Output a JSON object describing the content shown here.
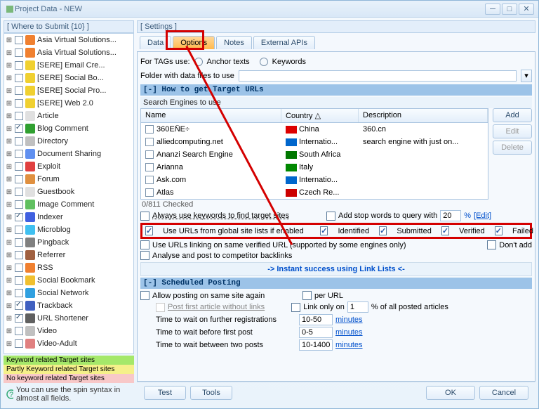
{
  "window": {
    "title": "Project Data - NEW"
  },
  "left_panel": {
    "header": "[ Where to Submit  {10} ]",
    "items": [
      {
        "label": "Asia Virtual Solutions...",
        "chk": false,
        "icon": "#f08030"
      },
      {
        "label": "Asia Virtual Solutions...",
        "chk": false,
        "icon": "#f08030"
      },
      {
        "label": "[SERE] Email Cre...",
        "chk": false,
        "icon": "#f0d030"
      },
      {
        "label": "[SERE] Social Bo...",
        "chk": false,
        "icon": "#f0d030"
      },
      {
        "label": "[SERE] Social Pro...",
        "chk": false,
        "icon": "#f0d030"
      },
      {
        "label": "[SERE] Web 2.0",
        "chk": false,
        "icon": "#f0d030"
      },
      {
        "label": "Article",
        "chk": false,
        "icon": "#e0e0e0"
      },
      {
        "label": "Blog Comment",
        "chk": true,
        "icon": "#30a030"
      },
      {
        "label": "Directory",
        "chk": false,
        "icon": "#c0c0c0"
      },
      {
        "label": "Document Sharing",
        "chk": false,
        "icon": "#6090f0"
      },
      {
        "label": "Exploit",
        "chk": false,
        "icon": "#e04040"
      },
      {
        "label": "Forum",
        "chk": false,
        "icon": "#e09040"
      },
      {
        "label": "Guestbook",
        "chk": false,
        "icon": "#e0e0e0"
      },
      {
        "label": "Image Comment",
        "chk": false,
        "icon": "#60c060"
      },
      {
        "label": "Indexer",
        "chk": true,
        "icon": "#4060e0"
      },
      {
        "label": "Microblog",
        "chk": false,
        "icon": "#40c0f0"
      },
      {
        "label": "Pingback",
        "chk": false,
        "icon": "#808080"
      },
      {
        "label": "Referrer",
        "chk": false,
        "icon": "#a06040"
      },
      {
        "label": "RSS",
        "chk": false,
        "icon": "#f08030"
      },
      {
        "label": "Social Bookmark",
        "chk": false,
        "icon": "#f0c030"
      },
      {
        "label": "Social Network",
        "chk": false,
        "icon": "#30a0e0"
      },
      {
        "label": "Trackback",
        "chk": true,
        "icon": "#4060c0"
      },
      {
        "label": "URL Shortener",
        "chk": true,
        "icon": "#606060"
      },
      {
        "label": "Video",
        "chk": false,
        "icon": "#c0c0c0"
      },
      {
        "label": "Video-Adult",
        "chk": false,
        "icon": "#e08080"
      }
    ],
    "legend": {
      "green": "Keyword related Target sites",
      "yellow": "Partly Keyword related Target sites",
      "pink": "No keyword related Target sites"
    },
    "hint": "You can use the spin syntax in almost all fields."
  },
  "settings_header": "[ Settings ]",
  "tabs": {
    "data": "Data",
    "options": "Options",
    "notes": "Notes",
    "apis": "External APIs"
  },
  "options": {
    "tags_label": "For TAGs use:",
    "anchor": "Anchor texts",
    "keywords": "Keywords",
    "folder_label": "Folder with data files to use",
    "section1": "[-]  How to get Target URLs",
    "se_label": "Search Engines to use",
    "cols": {
      "name": "Name",
      "country": "Country  △",
      "desc": "Description"
    },
    "engines": [
      {
        "name": "360EÑE÷",
        "country": "China",
        "flag": "#d00",
        "desc": "360.cn"
      },
      {
        "name": "alliedcomputing.net",
        "country": "Internatio...",
        "flag": "#06c",
        "desc": "search engine with just on..."
      },
      {
        "name": "Ananzi Search Engine",
        "country": "South Africa",
        "flag": "#070",
        "desc": ""
      },
      {
        "name": "Arianna",
        "country": "Italy",
        "flag": "#080",
        "desc": ""
      },
      {
        "name": "Ask.com",
        "country": "Internatio...",
        "flag": "#06c",
        "desc": ""
      },
      {
        "name": "Atlas",
        "country": "Czech Re...",
        "flag": "#c00",
        "desc": ""
      }
    ],
    "checked_count": "0/811 Checked",
    "always_kw": "Always use keywords to find target sites",
    "add_stop": "Add stop words to query with",
    "stop_val": "20",
    "stop_pct": "%",
    "edit_link": "[Edit]",
    "use_global": "Use URLs from global site lists if enabled",
    "identified": "Identified",
    "submitted": "Submitted",
    "verified": "Verified",
    "failed": "Failed",
    "use_same": "Use URLs linking on same verified URL (supported by some engines only)",
    "dont_add": "Don't add",
    "analyse": "Analyse and post to competitor backlinks",
    "instant": "->  Instant success using Link Lists  <-",
    "section2": "[-]  Scheduled Posting",
    "allow_same": "Allow posting on same site again",
    "per_url": "per URL",
    "post_first": "Post first article without links",
    "link_only": "Link only on",
    "link_only_val": "1",
    "link_only_suffix": "% of all posted articles",
    "wait_reg_label": "Time to wait on further registrations",
    "wait_reg_val": "10-50",
    "wait_first_label": "Time to wait before first post",
    "wait_first_val": "0-5",
    "wait_between_label": "Time to wait between two posts",
    "wait_between_val": "10-1400",
    "minutes": "minutes",
    "btn_add": "Add",
    "btn_edit": "Edit",
    "btn_delete": "Delete"
  },
  "footer": {
    "test": "Test",
    "tools": "Tools",
    "ok": "OK",
    "cancel": "Cancel"
  }
}
